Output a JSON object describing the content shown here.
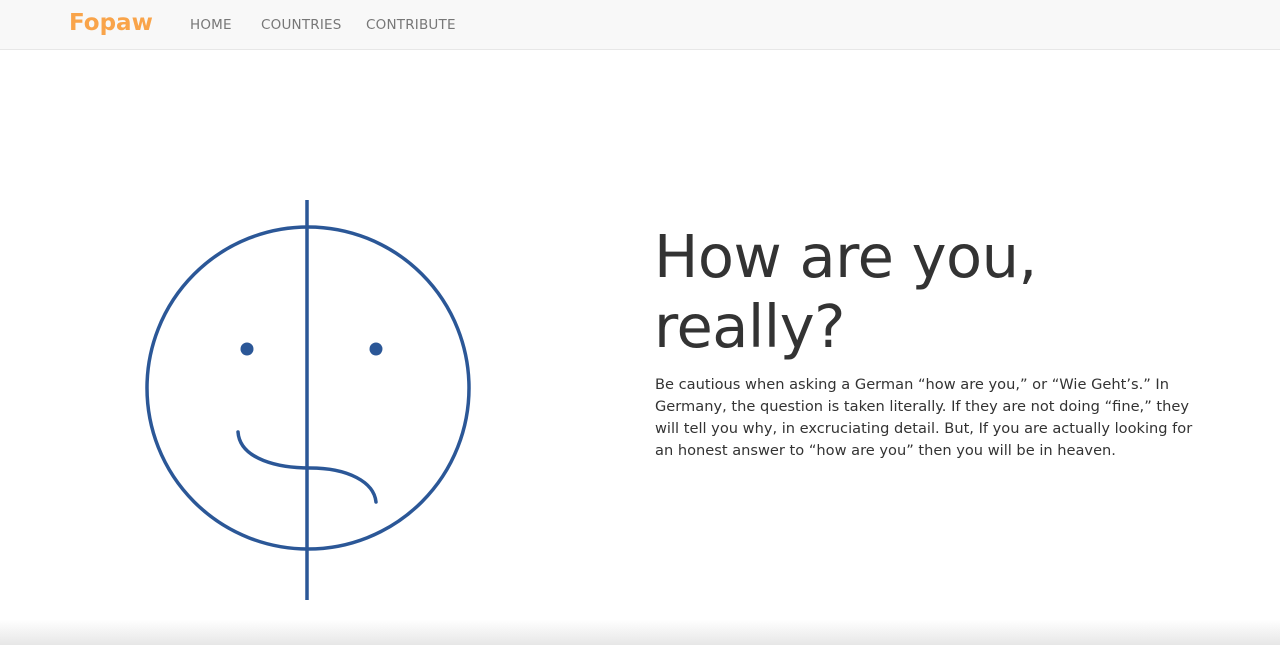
{
  "navbar": {
    "brand": "Fopaw",
    "links": [
      "HOME",
      "COUNTRIES",
      "CONTRIBUTE"
    ]
  },
  "hero": {
    "illustration": "half-smiling-half-sad-face-icon",
    "title_line1": "How are you,",
    "title_line2": "really?",
    "body": "Be cautious when asking a German “how are you,” or “Wie Geht’s.” In Germany, the question is taken literally. If they are not doing “fine,” they will tell you why, in excruciating detail. But, If you are actually looking for an honest answer to “how are you” then you will be in heaven."
  },
  "colors": {
    "brand": "#f9a44a",
    "nav_text": "#777777",
    "navbar_bg": "#f8f8f8",
    "illustration_stroke": "#2b5797",
    "text": "#333333"
  }
}
